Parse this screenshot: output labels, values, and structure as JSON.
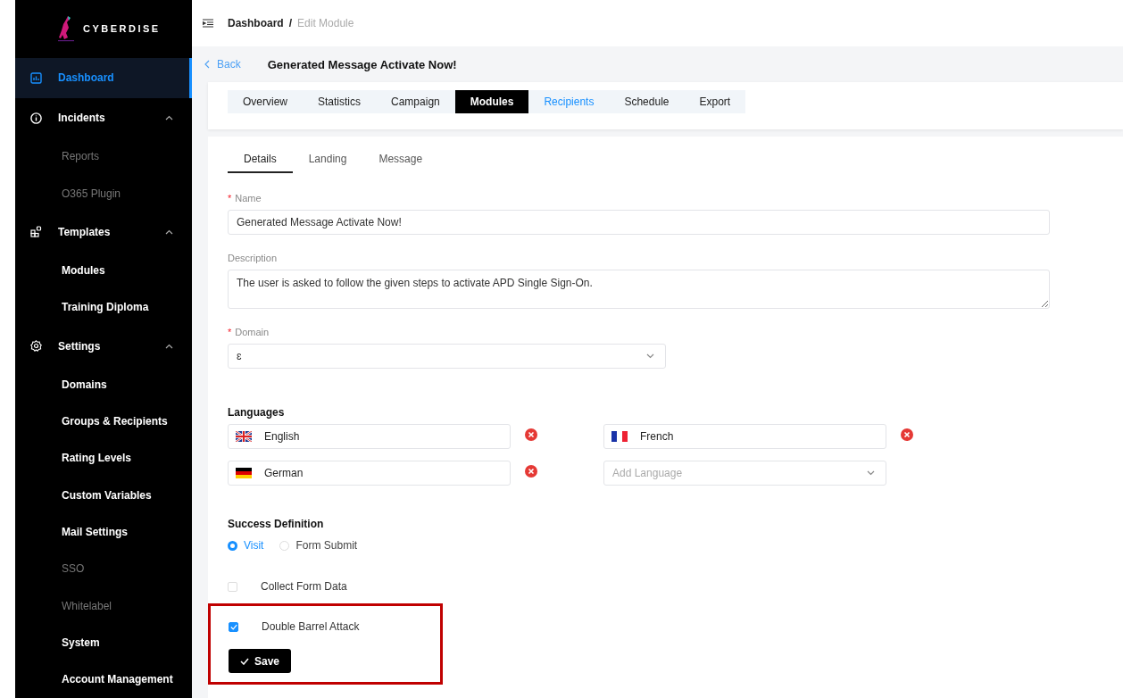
{
  "brand": {
    "name": "CYBERDISE"
  },
  "sidebar": {
    "items": [
      {
        "kind": "link",
        "label": "Dashboard",
        "selected": true
      },
      {
        "kind": "group",
        "label": "Incidents",
        "expanded": true,
        "children": [
          {
            "label": "Reports",
            "disabled": true,
            "selected": false
          },
          {
            "label": "O365 Plugin",
            "disabled": true,
            "selected": false
          }
        ]
      },
      {
        "kind": "group",
        "label": "Templates",
        "expanded": true,
        "children": [
          {
            "label": "Modules",
            "disabled": false,
            "selected": false
          },
          {
            "label": "Training Diploma",
            "disabled": false,
            "selected": false
          }
        ]
      },
      {
        "kind": "group",
        "label": "Settings",
        "expanded": true,
        "children": [
          {
            "label": "Domains",
            "disabled": false,
            "selected": false
          },
          {
            "label": "Groups & Recipients",
            "disabled": false,
            "selected": false
          },
          {
            "label": "Rating Levels",
            "disabled": false,
            "selected": false
          },
          {
            "label": "Custom Variables",
            "disabled": false,
            "selected": false
          },
          {
            "label": "Mail Settings",
            "disabled": false,
            "selected": false
          },
          {
            "label": "SSO",
            "disabled": true,
            "selected": false
          },
          {
            "label": "Whitelabel",
            "disabled": true,
            "selected": false
          },
          {
            "label": "System",
            "disabled": false,
            "selected": false
          },
          {
            "label": "Account Management",
            "disabled": false,
            "selected": false
          }
        ]
      }
    ]
  },
  "breadcrumb": [
    {
      "label": "Dashboard",
      "current": false
    },
    {
      "label": "/",
      "current": false
    },
    {
      "label": "Edit Module",
      "current": true
    }
  ],
  "back": {
    "label": "Back"
  },
  "page_title": "Generated Message Activate Now!",
  "tabs": [
    {
      "label": "Overview",
      "selected": false,
      "highlighted": false
    },
    {
      "label": "Statistics",
      "selected": false,
      "highlighted": false
    },
    {
      "label": "Campaign",
      "selected": false,
      "highlighted": false
    },
    {
      "label": "Modules",
      "selected": true,
      "highlighted": false
    },
    {
      "label": "Recipients",
      "selected": false,
      "highlighted": true
    },
    {
      "label": "Schedule",
      "selected": false,
      "highlighted": false
    },
    {
      "label": "Export",
      "selected": false,
      "highlighted": false
    }
  ],
  "subtabs": [
    {
      "label": "Details",
      "selected": true
    },
    {
      "label": "Landing",
      "selected": false
    },
    {
      "label": "Message",
      "selected": false
    }
  ],
  "form": {
    "name": {
      "marker": "*",
      "label": "Name",
      "value": "Generated Message Activate Now!"
    },
    "description": {
      "label": "Description",
      "value": "The user is asked to follow the given steps to activate APD Single Sign-On."
    },
    "domain": {
      "marker": "*",
      "label": "Domain",
      "value": "ɛ"
    },
    "languages": {
      "label": "Languages",
      "items": [
        {
          "name": "English",
          "kind": "uk"
        },
        {
          "name": "French",
          "kind": "fr"
        },
        {
          "name": "German",
          "kind": "de"
        }
      ],
      "add_placeholder": "Add Language"
    },
    "success": {
      "label": "Success Definition",
      "options": [
        {
          "label": "Visit",
          "selected": true
        },
        {
          "label": "Form Submit",
          "selected": false
        }
      ]
    },
    "checkboxes": [
      {
        "label": "Collect Form Data",
        "checked": false
      },
      {
        "label": "Double Barrel Attack",
        "checked": true
      }
    ],
    "save": {
      "label": "Save",
      "highlighted": true
    }
  }
}
